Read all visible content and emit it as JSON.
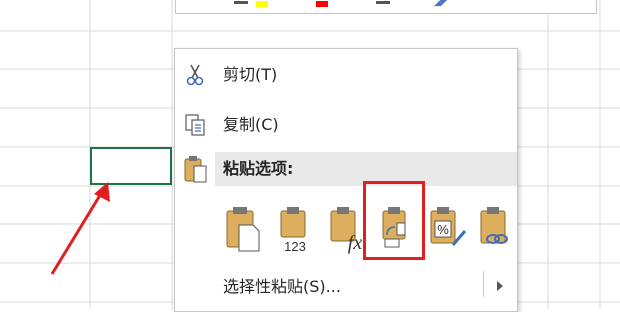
{
  "colors": {
    "cell_border": "#217346",
    "highlight": "#e02020",
    "clipboard": "#dcae5e",
    "menu_hover": "#e9e9e9"
  },
  "context_menu": {
    "cut_label": "剪切(T)",
    "copy_label": "复制(C)",
    "paste_options_header": "粘贴选项:",
    "paste_options": [
      {
        "icon": "paste-icon",
        "caption": ""
      },
      {
        "icon": "paste-values-icon",
        "caption": "123"
      },
      {
        "icon": "paste-formulas-icon",
        "caption": "fx"
      },
      {
        "icon": "paste-transpose-icon",
        "caption": ""
      },
      {
        "icon": "paste-formatting-icon",
        "caption": "%"
      },
      {
        "icon": "paste-link-icon",
        "caption": ""
      }
    ],
    "paste_special_label": "选择性粘贴(S)..."
  }
}
